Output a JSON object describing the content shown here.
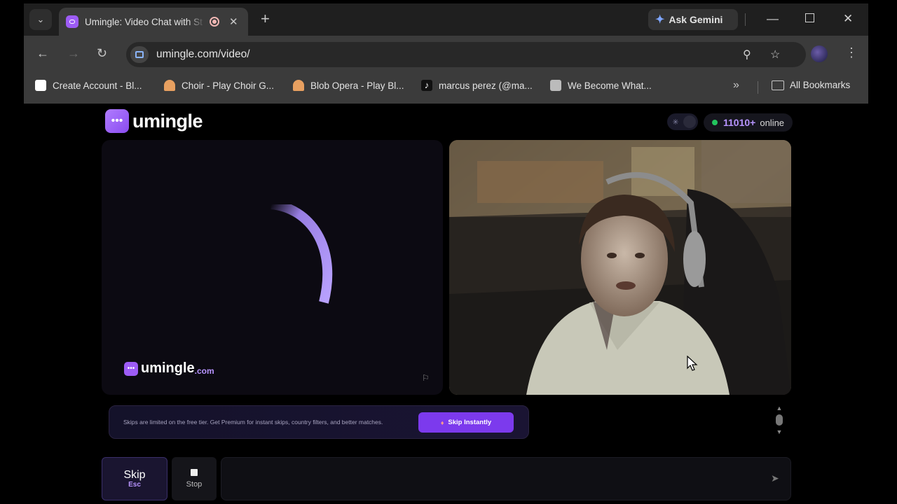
{
  "browser": {
    "tab": {
      "title": "Umingle: Video Chat with St"
    },
    "ask_gemini": "Ask Gemini",
    "url": "umingle.com/video/",
    "bookmarks": [
      {
        "label": "Create Account - Bl...",
        "icon": "bluesky-like-icon",
        "color": "#ffffff"
      },
      {
        "label": "Choir - Play Choir G...",
        "icon": "choir-singer-icon",
        "color": "#e8a060"
      },
      {
        "label": "Blob Opera - Play Bl...",
        "icon": "opera-singer-icon",
        "color": "#e8a060"
      },
      {
        "label": "marcus perez (@ma...",
        "icon": "tiktok-icon",
        "color": "#ffffff"
      },
      {
        "label": "We Become What...",
        "icon": "game-thumb-icon",
        "color": "#bbbbbb"
      }
    ],
    "all_bookmarks": "All Bookmarks"
  },
  "page": {
    "brand": "umingle",
    "online_count": "11010+",
    "online_label": "online",
    "watermark_name": "umingle",
    "watermark_domain": ".com",
    "banner_text": "Skips are limited on the free tier. Get Premium for instant skips, country filters, and better matches.",
    "skip_instantly": "Skip Instantly",
    "skip_label": "Skip",
    "skip_key": "Esc",
    "stop_label": "Stop",
    "message_placeholder": ""
  },
  "colors": {
    "accent": "#7c3aed",
    "brand": "#9d5cf5",
    "online": "#22c55e"
  }
}
